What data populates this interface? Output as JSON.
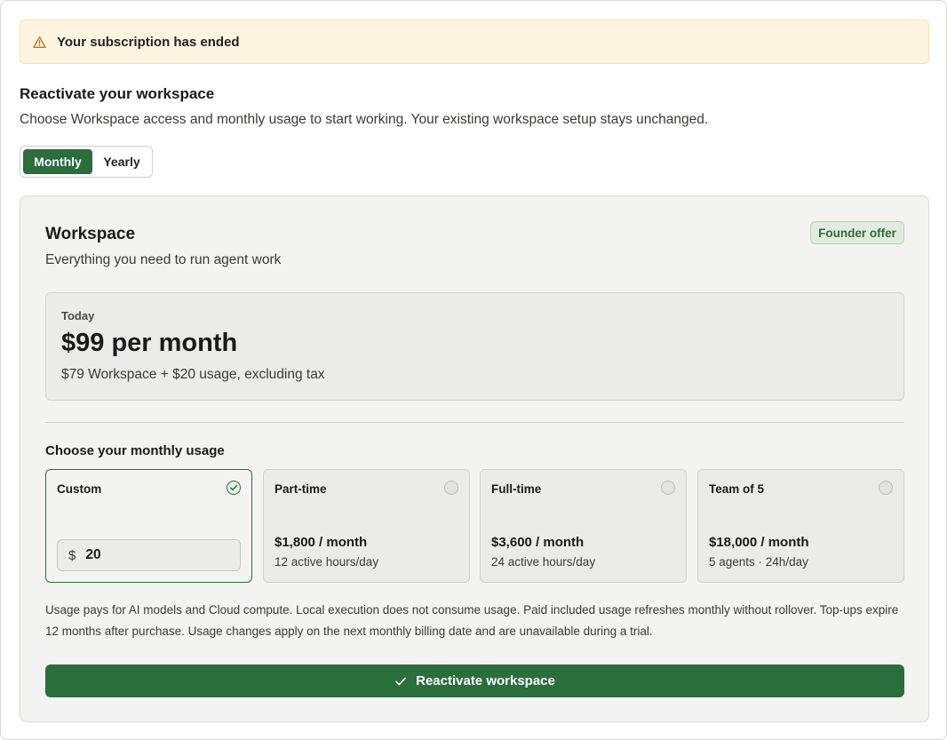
{
  "banner": {
    "text": "Your subscription has ended",
    "icon": "warning-icon"
  },
  "header": {
    "title": "Reactivate your workspace",
    "subtitle": "Choose Workspace access and monthly usage to start working. Your existing workspace setup stays unchanged."
  },
  "billing_toggle": {
    "monthly": "Monthly",
    "yearly": "Yearly",
    "selected": "Monthly"
  },
  "plan": {
    "title": "Workspace",
    "description": "Everything you need to run agent work",
    "badge": "Founder offer",
    "price_label": "Today",
    "price": "$99 per month",
    "price_detail": "$79 Workspace + $20 usage, excluding tax"
  },
  "usage": {
    "heading": "Choose your monthly usage",
    "custom": {
      "name": "Custom",
      "currency": "$",
      "value": "20",
      "selected": true
    },
    "options": [
      {
        "name": "Part-time",
        "price": "$1,800 / month",
        "meta": "12 active hours/day"
      },
      {
        "name": "Full-time",
        "price": "$3,600 / month",
        "meta": "24 active hours/day"
      },
      {
        "name": "Team of 5",
        "price": "$18,000 / month",
        "meta": "5 agents · 24h/day"
      }
    ],
    "notice": "Usage pays for AI models and Cloud compute. Local execution does not consume usage. Paid included usage refreshes monthly without rollover. Top-ups expire 12 months after purchase. Usage changes apply on the next monthly billing date and are unavailable during a trial."
  },
  "cta": {
    "label": "Reactivate workspace",
    "icon": "check-icon"
  },
  "colors": {
    "accent": "#2a6e3b",
    "banner_bg": "#fdf5df",
    "warning": "#c0761a",
    "card_bg": "#f3f4f2"
  }
}
